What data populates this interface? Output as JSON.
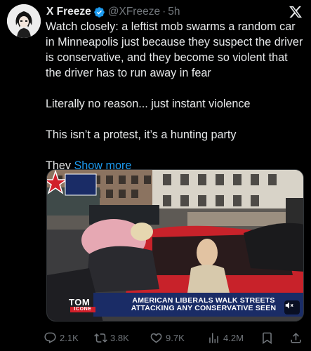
{
  "author": {
    "display_name": "X Freeze",
    "handle": "@XFreeze",
    "separator": "·",
    "time": "5h"
  },
  "tweet": {
    "paragraphs": [
      "Watch closely: a leftist mob swarms a random car in Minneapolis just because they suspect the driver is conservative, and they become so violent that the driver has to run away in fear",
      "Literally no reason... just instant violence",
      "This isn’t a protest, it’s a hunting party"
    ],
    "truncated_start": "They",
    "show_more_label": "Show more"
  },
  "media": {
    "caption_line1": "AMERICAN LIBERALS WALK STREETS",
    "caption_line2": "ATTACKING ANY CONSERVATIVE SEEN",
    "logo_line1": "TOM",
    "logo_line2": "ICONE",
    "muted": true
  },
  "actions": {
    "replies": "2.1K",
    "reposts": "3.8K",
    "likes": "9.7K",
    "views": "4.2M"
  },
  "colors": {
    "background": "#000000",
    "text": "#e7e9ea",
    "muted_text": "#71767b",
    "link": "#1d9bf0",
    "verified": "#1d9bf0",
    "caption_bar": "#1a2c66",
    "logo_red": "#d11f2a"
  },
  "icons": {
    "verified": "verified-badge-icon",
    "platform": "x-logo-icon",
    "reply": "reply-icon",
    "repost": "repost-icon",
    "like": "heart-icon",
    "views": "views-icon",
    "bookmark": "bookmark-icon",
    "share": "share-icon",
    "volume": "volume-muted-icon"
  }
}
